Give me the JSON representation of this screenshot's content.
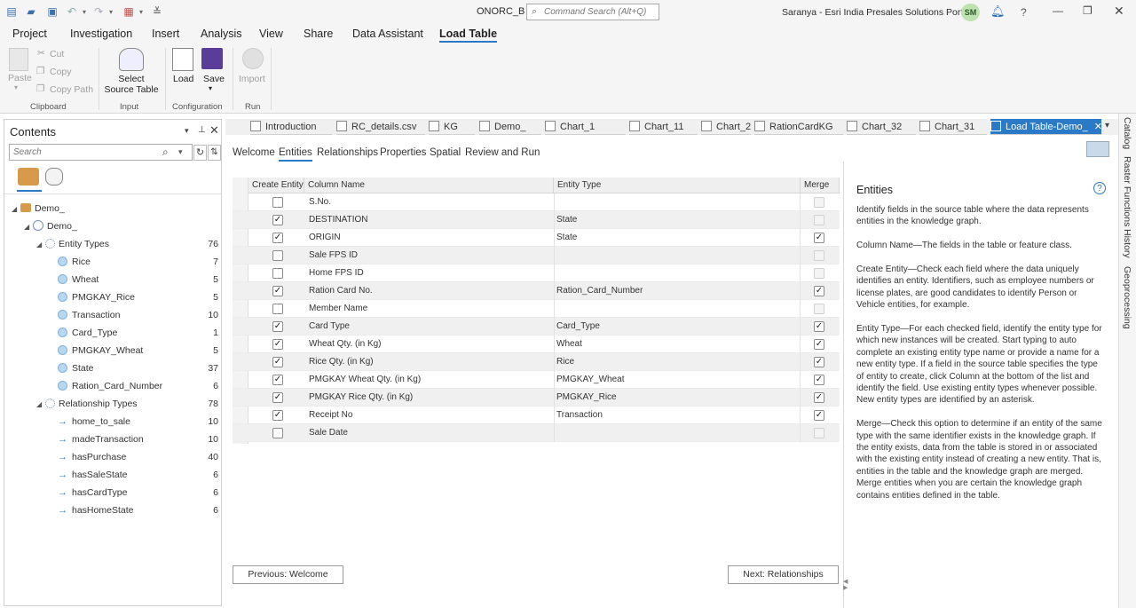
{
  "titlebar": {
    "doc_title": "ONORC_B",
    "search_placeholder": "Command Search (Alt+Q)",
    "portal": "Saranya - Esri India Presales Solutions Portal",
    "avatar": "SM",
    "help": "?"
  },
  "menu": {
    "items": [
      "Project",
      "Investigation",
      "Insert",
      "Analysis",
      "View",
      "Share",
      "Data Assistant",
      "Load Table"
    ],
    "active": "Load Table"
  },
  "ribbon": {
    "paste": "Paste",
    "cut": "Cut",
    "copy": "Copy",
    "copy_path": "Copy Path",
    "clipboard": "Clipboard",
    "select_source_table": [
      "Select",
      "Source Table"
    ],
    "input": "Input",
    "load": "Load",
    "save": "Save",
    "configuration": "Configuration",
    "import": "Import",
    "run": "Run"
  },
  "contents": {
    "title": "Contents",
    "search_placeholder": "Search",
    "tree": [
      {
        "label": "Demo_",
        "level": 0,
        "type": "group"
      },
      {
        "label": "Demo_",
        "level": 1,
        "type": "kg"
      },
      {
        "label": "Entity Types",
        "level": 2,
        "type": "entity-types",
        "count": "76"
      },
      {
        "label": "Rice",
        "level": 3,
        "type": "entity",
        "count": "7"
      },
      {
        "label": "Wheat",
        "level": 3,
        "type": "entity",
        "count": "5"
      },
      {
        "label": "PMGKAY_Rice",
        "level": 3,
        "type": "entity",
        "count": "5"
      },
      {
        "label": "Transaction",
        "level": 3,
        "type": "entity",
        "count": "10"
      },
      {
        "label": "Card_Type",
        "level": 3,
        "type": "entity",
        "count": "1"
      },
      {
        "label": "PMGKAY_Wheat",
        "level": 3,
        "type": "entity",
        "count": "5"
      },
      {
        "label": "State",
        "level": 3,
        "type": "entity",
        "count": "37"
      },
      {
        "label": "Ration_Card_Number",
        "level": 3,
        "type": "entity",
        "count": "6"
      },
      {
        "label": "Relationship Types",
        "level": 2,
        "type": "relationship-types",
        "count": "78"
      },
      {
        "label": "home_to_sale",
        "level": 3,
        "type": "relationship",
        "count": "10"
      },
      {
        "label": "madeTransaction",
        "level": 3,
        "type": "relationship",
        "count": "10"
      },
      {
        "label": "hasPurchase",
        "level": 3,
        "type": "relationship",
        "count": "40"
      },
      {
        "label": "hasSaleState",
        "level": 3,
        "type": "relationship",
        "count": "6"
      },
      {
        "label": "hasCardType",
        "level": 3,
        "type": "relationship",
        "count": "6"
      },
      {
        "label": "hasHomeState",
        "level": 3,
        "type": "relationship",
        "count": "6"
      }
    ]
  },
  "tabs": [
    "Introduction",
    "RC_details.csv",
    "KG",
    "Demo_",
    "Chart_1",
    "Chart_11",
    "Chart_2",
    "RationCardKG",
    "Chart_32",
    "Chart_31",
    "Load Table-Demo_"
  ],
  "dock": [
    "Catalog",
    "Raster Functions",
    "History",
    "Geoprocessing"
  ],
  "subtabs": [
    "Welcome",
    "Entities",
    "Relationships",
    "Properties",
    "Spatial",
    "Review and Run"
  ],
  "grid": {
    "headers": [
      "Create Entity",
      "Column Name",
      "Entity Type",
      "Merge"
    ],
    "rows": [
      {
        "create": false,
        "column": "S.No.",
        "entity": "",
        "merge": "disabled"
      },
      {
        "create": true,
        "column": "DESTINATION",
        "entity": "State",
        "merge": "disabled"
      },
      {
        "create": true,
        "column": "ORIGIN",
        "entity": "State",
        "merge": "checked"
      },
      {
        "create": false,
        "column": "Sale FPS ID",
        "entity": "",
        "merge": "disabled"
      },
      {
        "create": false,
        "column": "Home FPS ID",
        "entity": "",
        "merge": "disabled"
      },
      {
        "create": true,
        "column": "Ration Card No.",
        "entity": "Ration_Card_Number",
        "merge": "checked"
      },
      {
        "create": false,
        "column": "Member Name",
        "entity": "",
        "merge": "disabled"
      },
      {
        "create": true,
        "column": "Card Type",
        "entity": "Card_Type",
        "merge": "checked"
      },
      {
        "create": true,
        "column": "Wheat Qty. (in Kg)",
        "entity": "Wheat",
        "merge": "checked"
      },
      {
        "create": true,
        "column": "Rice Qty. (in Kg)",
        "entity": "Rice",
        "merge": "checked"
      },
      {
        "create": true,
        "column": "PMGKAY Wheat Qty. (in Kg)",
        "entity": "PMGKAY_Wheat",
        "merge": "checked"
      },
      {
        "create": true,
        "column": "PMGKAY Rice Qty. (in Kg)",
        "entity": "PMGKAY_Rice",
        "merge": "checked"
      },
      {
        "create": true,
        "column": "Receipt No",
        "entity": "Transaction",
        "merge": "checked"
      },
      {
        "create": false,
        "column": "Sale Date",
        "entity": "",
        "merge": "disabled"
      }
    ]
  },
  "nav": {
    "previous": "Previous: Welcome",
    "next": "Next: Relationships"
  },
  "help": {
    "title": "Entities",
    "paragraphs": [
      [
        "Identify fields in the source table where the data represents",
        "entities in the knowledge graph."
      ],
      [
        "Column Name—The fields in the table or feature class."
      ],
      [
        "Create Entity—Check each field where the data uniquely",
        "identifies an entity. Identifiers, such as employee numbers or",
        "license plates, are good candidates to identify Person or",
        "Vehicle entities, for example."
      ],
      [
        "Entity Type—For each checked field, identify the entity type for",
        "which new instances will be created. Start typing to auto",
        "complete an existing entity type name or provide a name for a",
        "new entity type. If a field in the source table specifies the type",
        "of entity to create, click Column at the bottom of the list and",
        "identify the field. Use existing entity types whenever possible.",
        "New entity types are identified by an asterisk."
      ],
      [
        "Merge—Check this option to determine if an entity of the same",
        "type with the same identifier exists in the knowledge graph. If",
        "the entity exists, data from the table is stored in or associated",
        "with the existing entity instead of creating a new entity. That is,",
        "entities in the table and the knowledge graph are merged.",
        "Merge entities when you are certain the knowledge graph",
        "contains entities defined in the table."
      ]
    ]
  },
  "colors": {
    "accent": "#2a7ac7",
    "avatar_bg": "#bde3b0"
  }
}
